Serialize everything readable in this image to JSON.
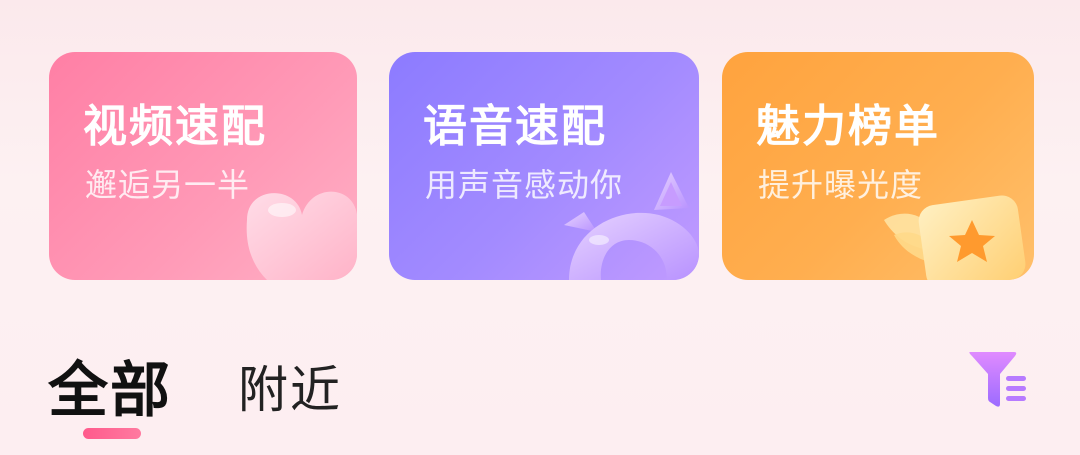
{
  "cards": [
    {
      "title": "视频速配",
      "subtitle": "邂逅另一半",
      "icon": "heart-icon"
    },
    {
      "title": "语音速配",
      "subtitle": "用声音感动你",
      "icon": "cat-ear-headphones-icon"
    },
    {
      "title": "魅力榜单",
      "subtitle": "提升曝光度",
      "icon": "winged-star-badge-icon"
    }
  ],
  "tabs": {
    "all": "全部",
    "nearby": "附近",
    "active": "all"
  },
  "filter": {
    "icon": "filter-icon"
  },
  "colors": {
    "pink": "#ff8aad",
    "purple": "#9d85ff",
    "orange": "#ffab4a",
    "indicator": "#ff5a8c",
    "filter": "#b77bff"
  }
}
